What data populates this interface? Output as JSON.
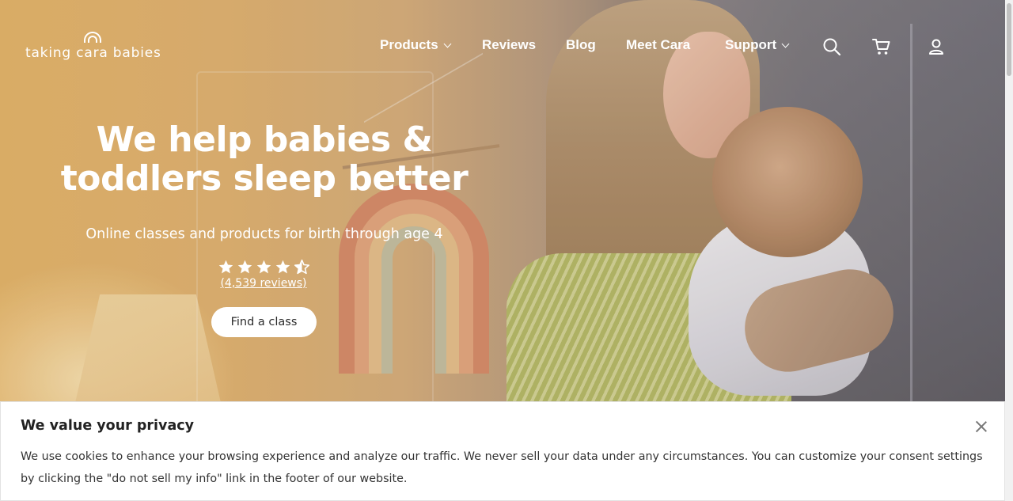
{
  "header": {
    "logo_text": "taking cara babies",
    "nav": [
      {
        "label": "Products",
        "has_dropdown": true
      },
      {
        "label": "Reviews",
        "has_dropdown": false
      },
      {
        "label": "Blog",
        "has_dropdown": false
      },
      {
        "label": "Meet Cara",
        "has_dropdown": false
      },
      {
        "label": "Support",
        "has_dropdown": true
      }
    ],
    "icons": [
      "search-icon",
      "cart-icon",
      "account-icon"
    ]
  },
  "hero": {
    "headline_line1": "We help babies &",
    "headline_line2": "toddlers sleep better",
    "subheadline": "Online classes and products for birth through age 4",
    "rating": 4.5,
    "reviews_link": "(4,539 reviews)",
    "cta_label": "Find a class"
  },
  "cookie_banner": {
    "title": "We value your privacy",
    "body": "We use cookies to enhance your browsing experience and analyze our traffic. We never sell your data under any circumstances. You can customize your consent settings by clicking the \"do not sell my info\" link in the footer of our website."
  },
  "colors": {
    "hero_warm": "#e7b86c",
    "text_on_hero": "#ffffff",
    "cta_bg": "#ffffff",
    "cta_text": "#2b2b2b"
  }
}
